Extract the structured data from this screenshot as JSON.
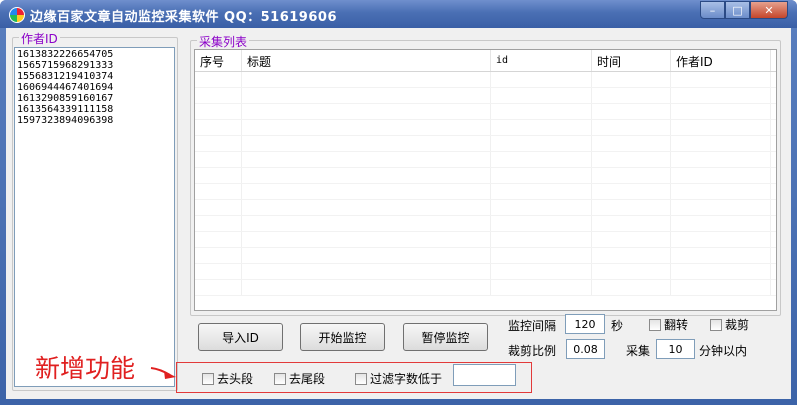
{
  "window": {
    "title": "边缘百家文章自动监控采集软件 QQ：51619606",
    "controls": {
      "minimize": "–",
      "maximize": "□",
      "close": "✕"
    }
  },
  "author_panel": {
    "title": "作者ID",
    "ids": [
      "1613832226654705",
      "1565715968291333",
      "1556831219410374",
      "1606944467401694",
      "1613290859160167",
      "1613564339111158",
      "1597323894096398"
    ]
  },
  "collect_panel": {
    "title": "采集列表",
    "columns": [
      "序号",
      "标题",
      "id",
      "时间",
      "作者ID"
    ],
    "rows": []
  },
  "buttons": {
    "import": "导入ID",
    "start": "开始监控",
    "pause": "暂停监控"
  },
  "settings": {
    "interval_label": "监控间隔",
    "interval_value": "120",
    "interval_unit": "秒",
    "flip_label": "翻转",
    "crop_label": "裁剪",
    "crop_ratio_label": "裁剪比例",
    "crop_ratio_value": "0.08",
    "collect_label": "采集",
    "collect_value": "10",
    "collect_unit": "分钟以内"
  },
  "new_features": {
    "annotation": "新增功能",
    "remove_head": "去头段",
    "remove_tail": "去尾段",
    "filter_label": "过滤字数低于",
    "filter_value": ""
  }
}
